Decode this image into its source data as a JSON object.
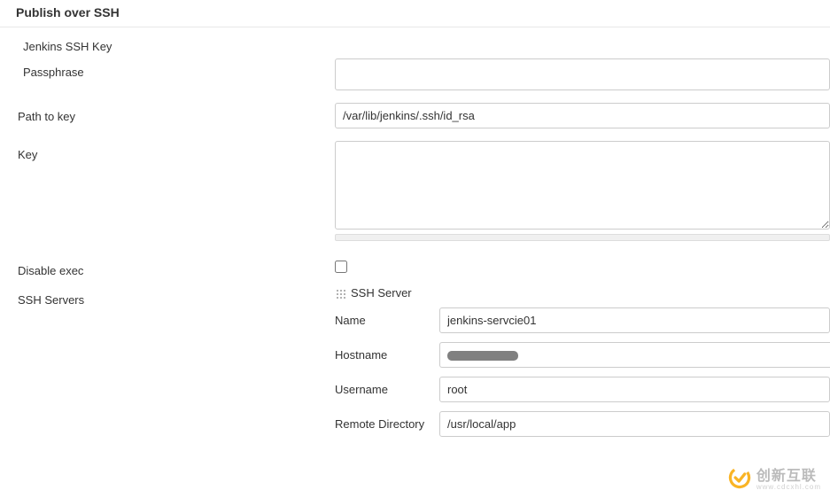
{
  "section": {
    "title": "Publish over SSH"
  },
  "ssh_key": {
    "heading": "Jenkins SSH Key",
    "passphrase_label": "Passphrase",
    "passphrase_value": "",
    "path_label": "Path to key",
    "path_value": "/var/lib/jenkins/.ssh/id_rsa",
    "key_label": "Key",
    "key_value": ""
  },
  "disable_exec": {
    "label": "Disable exec",
    "checked": false
  },
  "ssh_servers": {
    "label": "SSH Servers",
    "server_heading": "SSH Server",
    "name_label": "Name",
    "name_value": "jenkins-servcie01",
    "hostname_label": "Hostname",
    "hostname_value": "",
    "username_label": "Username",
    "username_value": "root",
    "remote_dir_label": "Remote Directory",
    "remote_dir_value": "/usr/local/app"
  },
  "watermark": {
    "text": "创新互联",
    "sub": "www.cdcxhl.com"
  }
}
